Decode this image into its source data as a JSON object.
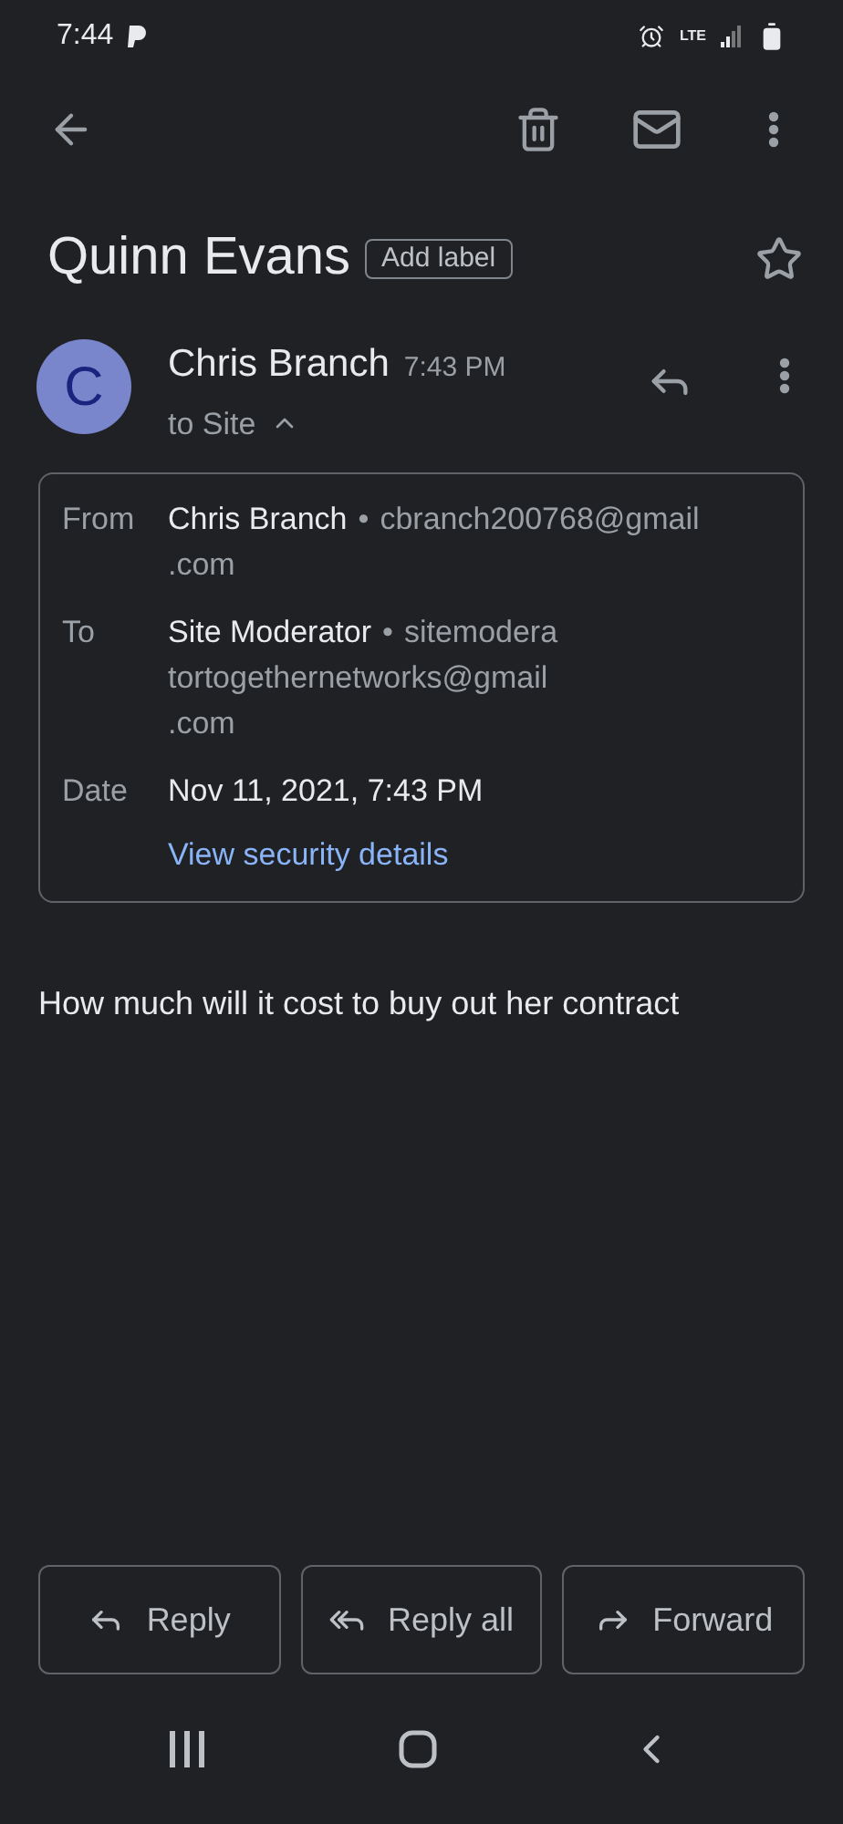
{
  "status_bar": {
    "time": "7:44",
    "network": "LTE"
  },
  "subject": {
    "title": "Quinn Evans",
    "label_button": "Add label",
    "starred": false
  },
  "message": {
    "avatar_letter": "C",
    "sender": "Chris Branch",
    "time": "7:43 PM",
    "recipients": "to Site",
    "details_expanded": true
  },
  "details": {
    "separator": "•",
    "rows": [
      {
        "label": "From",
        "name": "Chris Branch",
        "address_lines": [
          "cbranch200768@gmail",
          ".com"
        ]
      },
      {
        "label": "To",
        "name": "Site Moderator",
        "address_lines": [
          "sitemodera",
          "tortogethernetworks@gmail",
          ".com"
        ]
      },
      {
        "label": "Date",
        "value": "Nov 11, 2021, 7:43 PM"
      }
    ],
    "security_link": "View security details"
  },
  "body": "How much will it cost to buy out her contract",
  "actions": [
    {
      "kind": "reply",
      "label": "Reply"
    },
    {
      "kind": "reply_all",
      "label": "Reply all"
    },
    {
      "kind": "forward",
      "label": "Forward"
    }
  ]
}
